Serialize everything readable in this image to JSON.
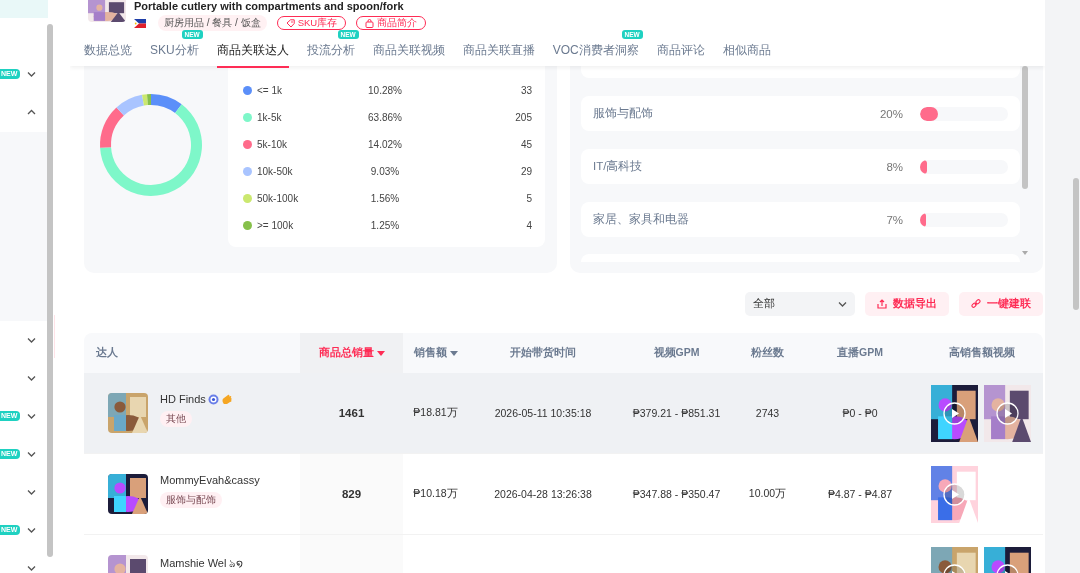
{
  "sidebar": {
    "items": [
      {
        "badge": "NEW",
        "expanded": false
      },
      {
        "expanded": true
      },
      {
        "expanded": false
      },
      {
        "expanded": false
      },
      {
        "badge": "NEW",
        "expanded": false
      },
      {
        "badge": "NEW",
        "expanded": false
      },
      {
        "expanded": false
      },
      {
        "badge": "NEW",
        "expanded": false
      },
      {
        "expanded": false
      }
    ]
  },
  "product": {
    "title": "Portable cutlery with compartments and spoon/fork",
    "category": "厨房用品 / 餐具 / 饭盒",
    "buttons": [
      {
        "kind": "sku",
        "label": "SKU库存"
      },
      {
        "kind": "intro",
        "label": "商品简介"
      }
    ]
  },
  "tabs": [
    {
      "label": "数据总览",
      "selected": false
    },
    {
      "label": "SKU分析",
      "selected": false,
      "badge": "NEW"
    },
    {
      "label": "商品关联达人",
      "selected": true
    },
    {
      "label": "投流分析",
      "selected": false,
      "badge": "NEW"
    },
    {
      "label": "商品关联视频",
      "selected": false
    },
    {
      "label": "商品关联直播",
      "selected": false
    },
    {
      "label": "VOC消费者洞察",
      "selected": false,
      "badge": "NEW"
    },
    {
      "label": "商品评论",
      "selected": false
    },
    {
      "label": "相似商品",
      "selected": false
    }
  ],
  "fans_card": {
    "chart_data": {
      "type": "donut",
      "categories": [
        "<= 1k",
        "1k-5k",
        "5k-10k",
        "10k-50k",
        "50k-100k",
        ">= 100k"
      ],
      "values": [
        10.28,
        63.86,
        14.02,
        9.03,
        1.56,
        1.25
      ]
    },
    "legend": [
      {
        "share": "10.28%",
        "count": "33",
        "color": "#5b8ff9"
      },
      {
        "share": "63.86%",
        "count": "205",
        "color": "#7ef7c9"
      },
      {
        "share": "14.02%",
        "count": "45",
        "color": "#ff6b8b"
      },
      {
        "share": "9.03%",
        "count": "29",
        "color": "#a9c4ff"
      },
      {
        "share": "1.56%",
        "count": "5",
        "color": "#cbe86f"
      },
      {
        "share": "1.25%",
        "count": "4",
        "color": "#86c04a"
      }
    ]
  },
  "category_card": {
    "rows": [
      {
        "label": "服饰与配饰",
        "share": "20%",
        "level": 0.2
      },
      {
        "label": "IT/高科技",
        "share": "8%",
        "level": 0.08
      },
      {
        "label": "家居、家具和电器",
        "share": "7%",
        "level": 0.07
      }
    ]
  },
  "toolbar": {
    "filter": "全部",
    "buttons": [
      {
        "kind": "export",
        "label": "数据导出"
      },
      {
        "kind": "link",
        "label": "一键建联"
      }
    ]
  },
  "table": {
    "columns": [
      {
        "label": "达人",
        "sortable": false,
        "sorted": false
      },
      {
        "label": "商品总销量",
        "sortable": true,
        "sorted": true
      },
      {
        "label": "销售额",
        "sortable": true,
        "sorted": false
      },
      {
        "label": "开始带货时间",
        "sortable": false,
        "sorted": false
      },
      {
        "label": "视频GPM",
        "sortable": false,
        "sorted": false
      },
      {
        "label": "粉丝数",
        "sortable": false,
        "sorted": false
      },
      {
        "label": "直播GPM",
        "sortable": false,
        "sorted": false
      },
      {
        "label": "高销售额视频",
        "sortable": false,
        "sorted": false
      }
    ],
    "rows": [
      {
        "name": "HD Finds",
        "verified": true,
        "hand": true,
        "tag": "其他",
        "sales": "1461",
        "revenue": "₱18.81万",
        "start_time": "2026-05-11 10:35:18",
        "video_gpm": "₱379.21 - ₱851.31",
        "fans": "2743",
        "live_gpm": "₱0 - ₱0",
        "highlighted": true
      },
      {
        "name": "MommyEvah&cassy",
        "verified": false,
        "hand": false,
        "tag": "服饰与配饰",
        "sales": "829",
        "revenue": "₱10.18万",
        "start_time": "2026-04-28 13:26:38",
        "video_gpm": "₱347.88 - ₱350.47",
        "fans": "10.00万",
        "live_gpm": "₱4.87 - ₱4.87",
        "highlighted": false
      },
      {
        "name": "Mamshie Wel ঌ໑",
        "verified": false,
        "hand": false,
        "highlighted": false
      }
    ]
  }
}
